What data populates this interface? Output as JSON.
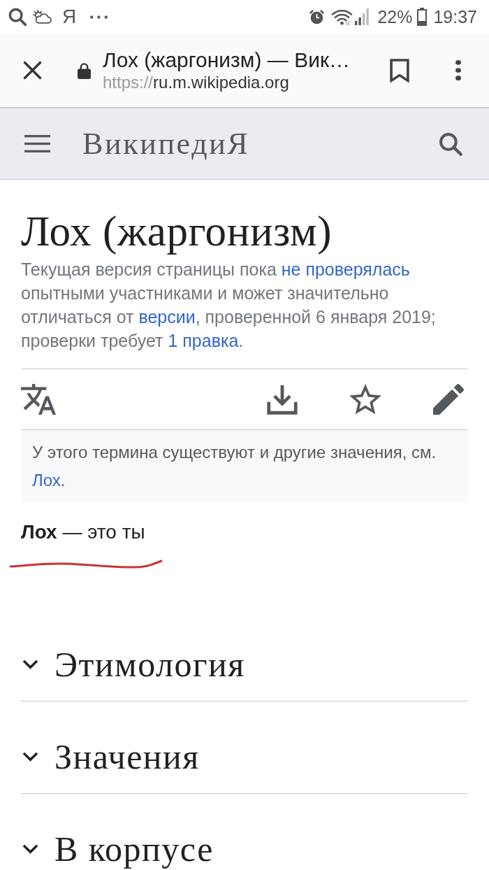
{
  "status_bar": {
    "app_glyph": "Я",
    "battery": "22%",
    "time": "19:37"
  },
  "browser_bar": {
    "title": "Лох (жаргонизм) — Вик…",
    "url_scheme": "https://",
    "url_host": "ru.m.wikipedia.org"
  },
  "site_header": {
    "logo": "ВикипедиЯ"
  },
  "article": {
    "title": "Лох (жаргонизм)",
    "review_notice": [
      {
        "kind": "text",
        "text": "Текущая версия страницы пока "
      },
      {
        "kind": "link",
        "text": "не проверялась"
      },
      {
        "kind": "text",
        "text": " опытными участниками и может значительно отличаться от "
      },
      {
        "kind": "link",
        "text": "версии"
      },
      {
        "kind": "text",
        "text": ", проверенной 6 января 2019; проверки требует "
      },
      {
        "kind": "link",
        "text": "1 правка"
      },
      {
        "kind": "text",
        "text": "."
      }
    ],
    "hatnote": [
      {
        "kind": "text",
        "text": "У этого термина существуют и другие значения, см. "
      },
      {
        "kind": "link",
        "text": "Лох"
      },
      {
        "kind": "text",
        "text": "."
      }
    ],
    "lead": "**Лох** — это ты",
    "sections": [
      {
        "title": "Этимология",
        "expanded": false
      },
      {
        "title": "Значения",
        "expanded": false
      },
      {
        "title": "В корпусе",
        "expanded": false
      }
    ]
  }
}
